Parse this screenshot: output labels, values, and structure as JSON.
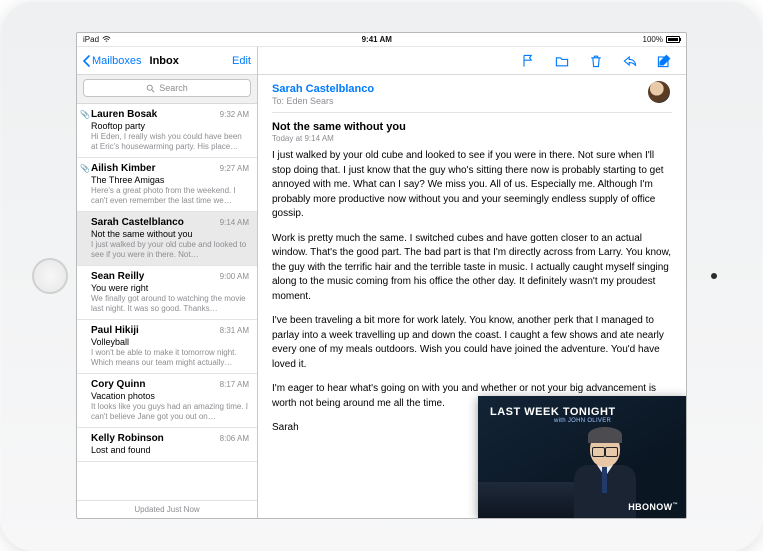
{
  "status": {
    "carrier": "iPad",
    "time": "9:41 AM",
    "battery": "100%"
  },
  "nav": {
    "back": "Mailboxes",
    "title": "Inbox",
    "edit": "Edit"
  },
  "search": {
    "placeholder": "Search"
  },
  "messages": [
    {
      "sender": "Lauren Bosak",
      "time": "9:32 AM",
      "subject": "Rooftop party",
      "preview": "Hi Eden, I really wish you could have been at Eric's housewarming party. His place…",
      "attachment": true
    },
    {
      "sender": "Ailish Kimber",
      "time": "9:27 AM",
      "subject": "The Three Amigas",
      "preview": "Here's a great photo from the weekend. I can't even remember the last time we…",
      "attachment": true
    },
    {
      "sender": "Sarah Castelblanco",
      "time": "9:14 AM",
      "subject": "Not the same without you",
      "preview": "I just walked by your old cube and looked to see if you were in there. Not…",
      "selected": true
    },
    {
      "sender": "Sean Reilly",
      "time": "9:00 AM",
      "subject": "You were right",
      "preview": "We finally got around to watching the movie last night. It was so good. Thanks…"
    },
    {
      "sender": "Paul Hikiji",
      "time": "8:31 AM",
      "subject": "Volleyball",
      "preview": "I won't be able to make it tomorrow night. Which means our team might actually…"
    },
    {
      "sender": "Cory Quinn",
      "time": "8:17 AM",
      "subject": "Vacation photos",
      "preview": "It looks like you guys had an amazing time. I can't believe Jane got you out on…"
    },
    {
      "sender": "Kelly Robinson",
      "time": "8:06 AM",
      "subject": "Lost and found",
      "preview": ""
    }
  ],
  "list_footer": "Updated Just Now",
  "detail": {
    "from": "Sarah Castelblanco",
    "to": "To: Eden Sears",
    "subject": "Not the same without you",
    "when": "Today at 9:14 AM",
    "p1": "I just walked by your old cube and looked to see if you were in there. Not sure when I'll stop doing that. I just know that the guy who's sitting there now is probably starting to get annoyed with me. What can I say? We miss you. All of us. Especially me. Although I'm probably more productive now without you and your seemingly endless supply of office gossip.",
    "p2": "Work is pretty much the same. I switched cubes and have gotten closer to an actual window. That's the good part. The bad part is that I'm directly across from Larry. You know, the guy with the terrific hair and the terrible taste in music. I actually caught myself singing along to the music coming from his office the other day. It definitely wasn't my proudest moment.",
    "p3": "I've been traveling a bit more for work lately. You know, another perk that I managed to parlay into a week travelling up and down the coast. I caught a few shows and ate nearly every one of my meals outdoors. Wish you could have joined the adventure. You'd have loved it.",
    "p4": "I'm eager to hear what's going on with you and whether or not your big advancement is worth not being around me all the time.",
    "sig": "Sarah"
  },
  "pip": {
    "title1": "LAST WEEK TONIGHT",
    "title2": "with JOHN OLIVER",
    "brand": "HBONOW"
  }
}
